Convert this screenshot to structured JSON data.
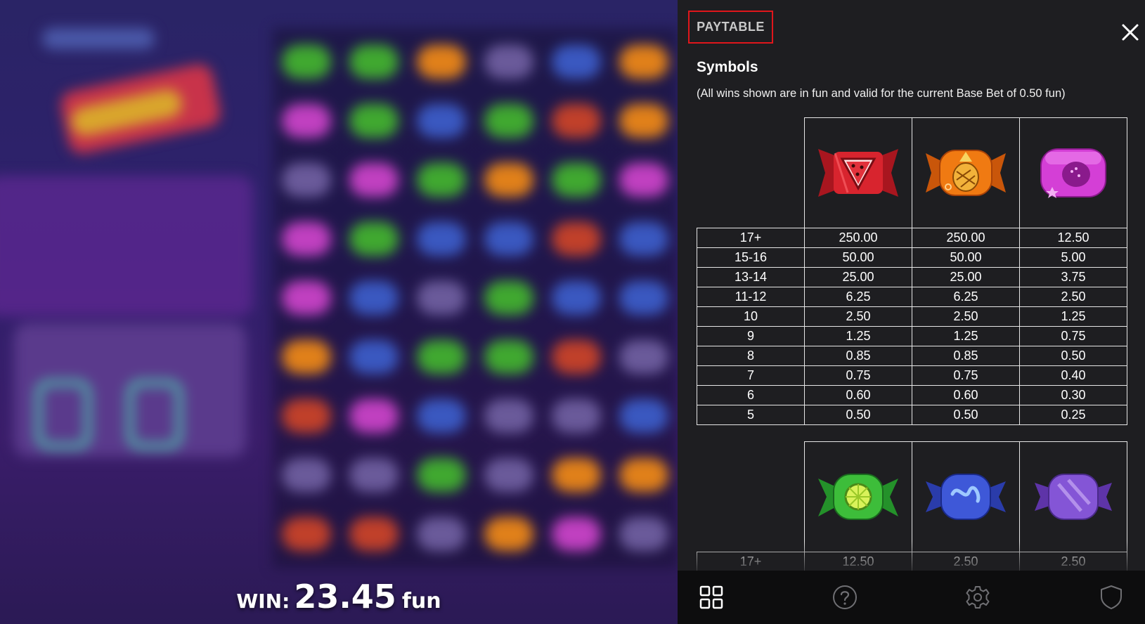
{
  "game": {
    "win_label": "WIN:",
    "win_amount": "23.45",
    "win_currency": "fun"
  },
  "paytable": {
    "title": "PAYTABLE",
    "close_icon": "close-icon",
    "section_heading": "Symbols",
    "section_note": "(All wins shown are in fun and valid for the current Base Bet of 0.50 fun)",
    "table1": {
      "symbols": [
        {
          "icon": "watermelon-candy-icon",
          "color": "#d8242e"
        },
        {
          "icon": "pineapple-candy-icon",
          "color": "#f07a12"
        },
        {
          "icon": "strawberry-candy-icon",
          "color": "#d43fd6"
        }
      ],
      "rows": [
        {
          "count": "17+",
          "values": [
            "250.00",
            "250.00",
            "12.50"
          ]
        },
        {
          "count": "15-16",
          "values": [
            "50.00",
            "50.00",
            "5.00"
          ]
        },
        {
          "count": "13-14",
          "values": [
            "25.00",
            "25.00",
            "3.75"
          ]
        },
        {
          "count": "11-12",
          "values": [
            "6.25",
            "6.25",
            "2.50"
          ]
        },
        {
          "count": "10",
          "values": [
            "2.50",
            "2.50",
            "1.25"
          ]
        },
        {
          "count": "9",
          "values": [
            "1.25",
            "1.25",
            "0.75"
          ]
        },
        {
          "count": "8",
          "values": [
            "0.85",
            "0.85",
            "0.50"
          ]
        },
        {
          "count": "7",
          "values": [
            "0.75",
            "0.75",
            "0.40"
          ]
        },
        {
          "count": "6",
          "values": [
            "0.60",
            "0.60",
            "0.30"
          ]
        },
        {
          "count": "5",
          "values": [
            "0.50",
            "0.50",
            "0.25"
          ]
        }
      ]
    },
    "table2": {
      "symbols": [
        {
          "icon": "lime-candy-icon",
          "color": "#3dbd3a"
        },
        {
          "icon": "blue-swirl-candy-icon",
          "color": "#3e58d8"
        },
        {
          "icon": "purple-candy-icon",
          "color": "#8455d6"
        }
      ],
      "rows": [
        {
          "count": "17+",
          "values": [
            "12.50",
            "2.50",
            "2.50"
          ]
        }
      ]
    }
  },
  "bottom_nav": [
    {
      "icon": "grid-icon",
      "name": "nav-paytable"
    },
    {
      "icon": "help-icon",
      "name": "nav-help"
    },
    {
      "icon": "gear-icon",
      "name": "nav-settings"
    },
    {
      "icon": "shield-icon",
      "name": "nav-responsible-gaming"
    }
  ]
}
